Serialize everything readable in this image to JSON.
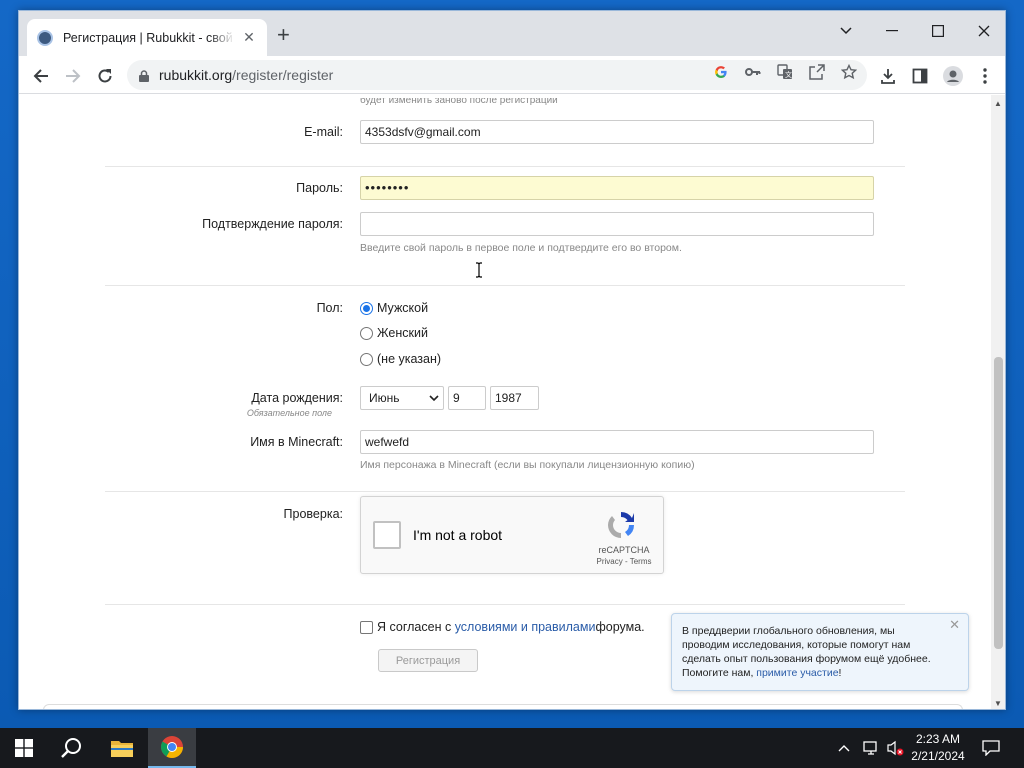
{
  "browser": {
    "tab_title": "Регистрация | Rubukkit - свой сервер",
    "url_host": "rubukkit.org",
    "url_path": "/register/register"
  },
  "form": {
    "top_cut_text": "будет изменить заново после регистрации",
    "email_label": "E-mail:",
    "email_value": "4353dsfv@gmail.com",
    "password_label": "Пароль:",
    "password_value": "••••••••",
    "confirm_label": "Подтверждение пароля:",
    "confirm_value": "",
    "password_hint": "Введите свой пароль в первое поле и подтвердите его во втором.",
    "gender_label": "Пол:",
    "gender_options": [
      "Мужской",
      "Женский",
      "(не указан)"
    ],
    "gender_selected": "Мужской",
    "dob_label": "Дата рождения:",
    "dob_required": "Обязательное поле",
    "dob_month": "Июнь",
    "dob_day": "9",
    "dob_year": "1987",
    "mc_label": "Имя в Minecraft:",
    "mc_value": "wefwefd",
    "mc_hint": "Имя персонажа в Minecraft (если вы покупали лицензионную копию)",
    "verify_label": "Проверка:",
    "captcha_text": "I'm not a robot",
    "captcha_brand": "reCAPTCHA",
    "captcha_links": "Privacy - Terms",
    "agree_prefix": "Я согласен с ",
    "agree_link": "условиями и правилами",
    "agree_suffix": " форума.",
    "submit_label": "Регистрация"
  },
  "notice": {
    "text": "В преддверии глобального обновления, мы проводим исследования, которые помогут нам сделать опыт пользования форумом ещё удобнее. Помогите нам, ",
    "link": "примите участие",
    "end": "!"
  },
  "taskbar": {
    "time": "2:23 AM",
    "date": "2/21/2024"
  }
}
